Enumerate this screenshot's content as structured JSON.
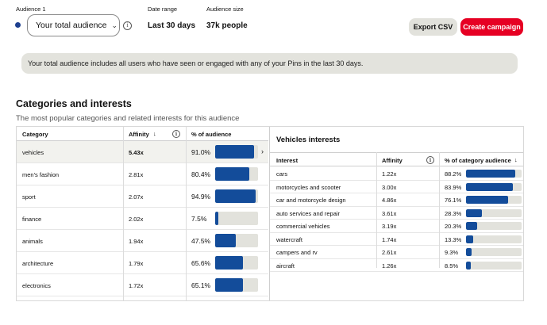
{
  "header": {
    "audience_label": "Audience 1",
    "audience_value": "Your total audience",
    "audience_chevron": "⌄",
    "audience_info_icon": "info-icon",
    "date_range_label": "Date range",
    "date_range_value": "Last 30 days",
    "audience_size_label": "Audience size",
    "audience_size_value": "37k people",
    "export_label": "Export CSV",
    "create_label": "Create campaign"
  },
  "banner": "Your total audience includes all users who have seen or engaged with any of your Pins in the last 30 days.",
  "section": {
    "title": "Categories and interests",
    "subtitle": "The most popular categories and related interests for this audience"
  },
  "categories_table": {
    "headers": {
      "category": "Category",
      "affinity": "Affinity",
      "sort_arrow": "↓",
      "percent": "% of audience"
    },
    "rows": [
      {
        "category": "vehicles",
        "affinity": "5.43x",
        "percent": "91.0%",
        "fraction": 0.91,
        "selected": true
      },
      {
        "category": "men's fashion",
        "affinity": "2.81x",
        "percent": "80.4%",
        "fraction": 0.804,
        "selected": false
      },
      {
        "category": "sport",
        "affinity": "2.07x",
        "percent": "94.9%",
        "fraction": 0.949,
        "selected": false
      },
      {
        "category": "finance",
        "affinity": "2.02x",
        "percent": "7.5%",
        "fraction": 0.075,
        "selected": false
      },
      {
        "category": "animals",
        "affinity": "1.94x",
        "percent": "47.5%",
        "fraction": 0.475,
        "selected": false
      },
      {
        "category": "architecture",
        "affinity": "1.79x",
        "percent": "65.6%",
        "fraction": 0.656,
        "selected": false
      },
      {
        "category": "electronics",
        "affinity": "1.72x",
        "percent": "65.1%",
        "fraction": 0.651,
        "selected": false
      },
      {
        "category": "",
        "affinity": "",
        "percent": "",
        "fraction": 0.5,
        "selected": false
      }
    ],
    "selected_arrow": "›"
  },
  "interests_panel": {
    "title": "Vehicles interests",
    "headers": {
      "interest": "Interest",
      "affinity": "Affinity",
      "percent": "% of category audience",
      "sort_arrow": "↓"
    },
    "rows": [
      {
        "interest": "cars",
        "affinity": "1.22x",
        "percent": "88.2%",
        "fraction": 0.882
      },
      {
        "interest": "motorcycles and scooter",
        "affinity": "3.00x",
        "percent": "83.9%",
        "fraction": 0.839
      },
      {
        "interest": "car and motorcycle design",
        "affinity": "4.86x",
        "percent": "76.1%",
        "fraction": 0.761
      },
      {
        "interest": "auto services and repair",
        "affinity": "3.61x",
        "percent": "28.3%",
        "fraction": 0.283
      },
      {
        "interest": "commercial vehicles",
        "affinity": "3.19x",
        "percent": "20.3%",
        "fraction": 0.203
      },
      {
        "interest": "watercraft",
        "affinity": "1.74x",
        "percent": "13.3%",
        "fraction": 0.133
      },
      {
        "interest": "campers and rv",
        "affinity": "2.61x",
        "percent": "9.3%",
        "fraction": 0.093
      },
      {
        "interest": "aircraft",
        "affinity": "1.26x",
        "percent": "8.5%",
        "fraction": 0.085
      }
    ]
  },
  "colors": {
    "accent": "#e60023",
    "bar": "#134c9a",
    "bar_track": "#e2e2dc",
    "dot": "#1d3f8f"
  }
}
